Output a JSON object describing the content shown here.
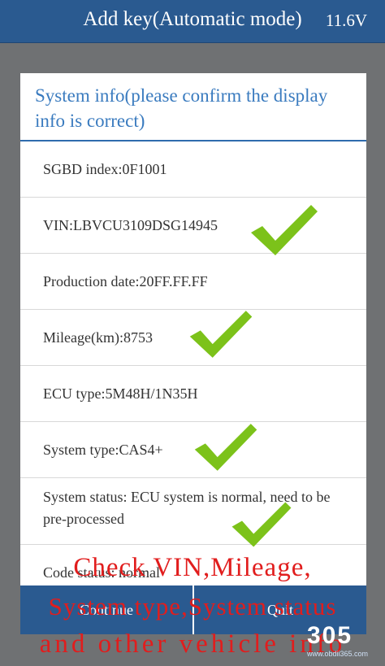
{
  "header": {
    "title": "Add key(Automatic mode)",
    "voltage": "11.6V"
  },
  "dialog": {
    "title": "System info(please confirm the display info is correct)",
    "rows": [
      "SGBD index:0F1001",
      "VIN:LBVCU3109DSG14945",
      "Production date:20FF.FF.FF",
      "Mileage(km):8753",
      "ECU type:5M48H/1N35H",
      "System type:CAS4+",
      "System status: ECU system is normal, need to be pre-processed",
      "Code status: normal"
    ],
    "buttons": {
      "continue": "Continue",
      "quit": "Quit"
    }
  },
  "overlay": {
    "line1": "Check VIN,Mileage,",
    "line2": "System type,System status",
    "line3": "and other vehicle info"
  },
  "watermark": {
    "logo": "305",
    "site": "www.obdii365.com"
  },
  "colors": {
    "header_bg": "#2a5a90",
    "title_text": "#3a7bbf",
    "check_green": "#7cc21a",
    "annotation_red": "#e11d1d"
  }
}
